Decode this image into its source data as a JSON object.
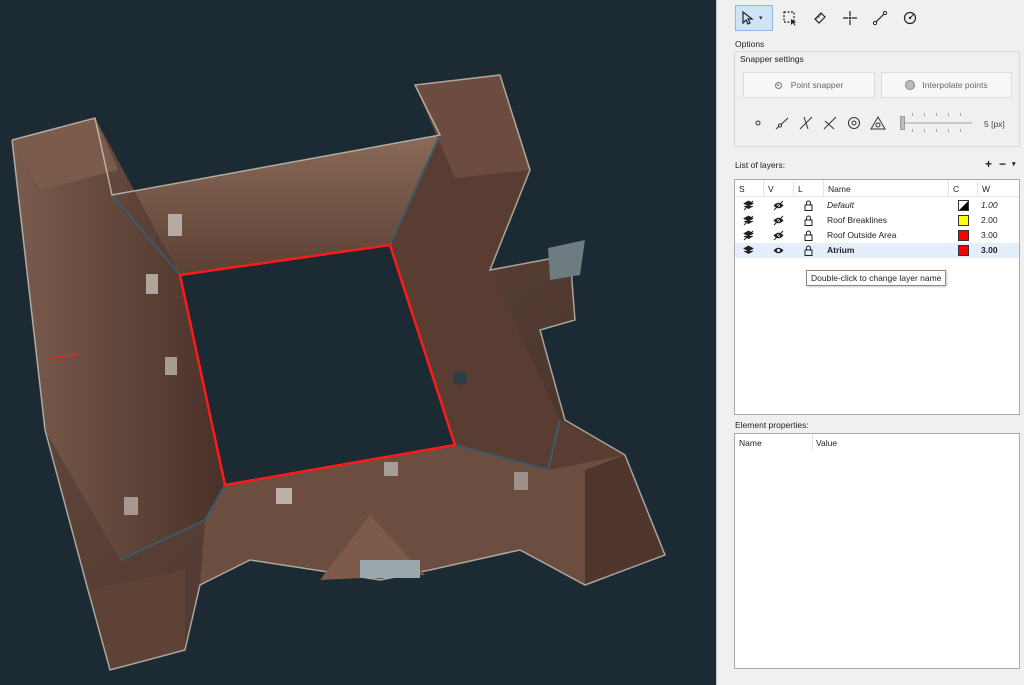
{
  "toolbar": {
    "tools": [
      {
        "icon": "select-arrow-icon",
        "active": true
      },
      {
        "icon": "rectangle-select-icon"
      },
      {
        "icon": "ruler-icon"
      },
      {
        "icon": "crosshair-point-icon"
      },
      {
        "icon": "line-tool-icon"
      },
      {
        "icon": "circle-tool-icon"
      }
    ]
  },
  "options": {
    "label": "Options",
    "snapper_title": "Snapper settings",
    "point_snapper": "Point snapper",
    "interpolate_points": "Interpolate points",
    "snap_icons": [
      "snap-point-icon",
      "snap-line-icon",
      "snap-intersection-icon",
      "snap-perpendicular-icon",
      "snap-circle-icon",
      "snap-triangle-icon"
    ],
    "slider_value": "5 [px]"
  },
  "layers": {
    "label": "List of layers:",
    "add": "+",
    "remove": "−",
    "menu": "▾",
    "columns": {
      "s": "S",
      "v": "V",
      "l": "L",
      "name": "Name",
      "c": "C",
      "w": "W"
    },
    "rows": [
      {
        "name": "Default",
        "color": "mixed",
        "width": "1.00",
        "style": "italic"
      },
      {
        "name": "Roof Breaklines",
        "color": "#ffff00",
        "width": "2.00",
        "style": "normal"
      },
      {
        "name": "Roof Outside Area",
        "color": "#ff0000",
        "width": "3.00",
        "style": "normal"
      },
      {
        "name": "Atrium",
        "color": "#ff0000",
        "width": "3.00",
        "style": "bold"
      }
    ],
    "tooltip": "Double-click to change layer name"
  },
  "properties": {
    "label": "Element properties:",
    "columns": {
      "name": "Name",
      "value": "Value"
    }
  },
  "colors": {
    "viewport_bg": "#1b2a33",
    "highlight_line": "#ff1a1a",
    "selected_row": "#e4effb"
  }
}
